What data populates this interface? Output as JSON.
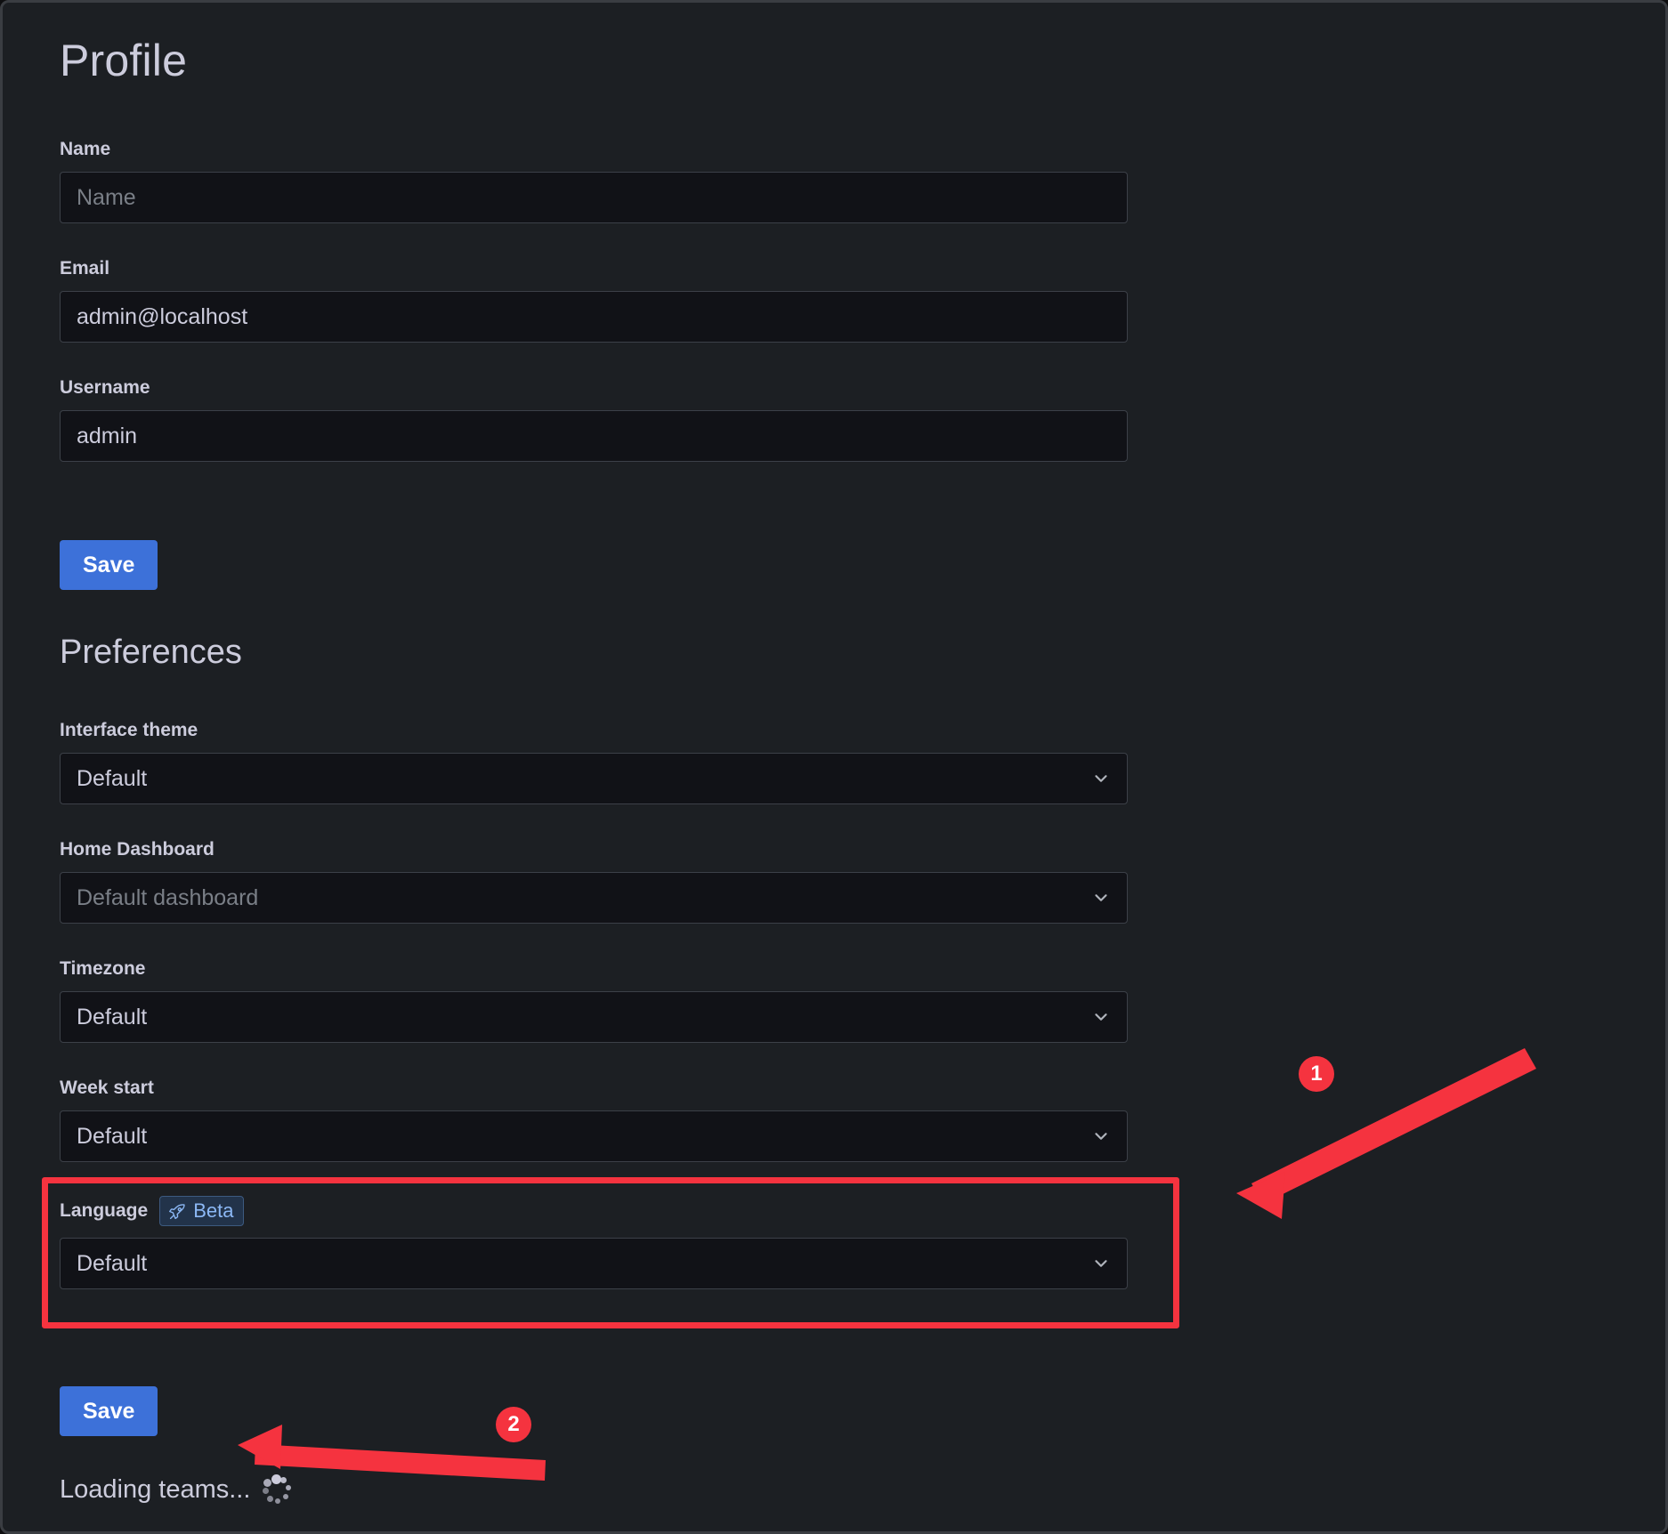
{
  "page": {
    "title": "Profile",
    "section_title": "Preferences"
  },
  "profile": {
    "fields": [
      {
        "label": "Name",
        "value": "",
        "placeholder": "Name"
      },
      {
        "label": "Email",
        "value": "admin@localhost",
        "placeholder": ""
      },
      {
        "label": "Username",
        "value": "admin",
        "placeholder": ""
      }
    ],
    "save_label": "Save"
  },
  "preferences": {
    "fields": [
      {
        "label": "Interface theme",
        "value": "Default",
        "is_placeholder": false
      },
      {
        "label": "Home Dashboard",
        "value": "Default dashboard",
        "is_placeholder": true
      },
      {
        "label": "Timezone",
        "value": "Default",
        "is_placeholder": false
      },
      {
        "label": "Week start",
        "value": "Default",
        "is_placeholder": false
      },
      {
        "label": "Language",
        "value": "Default",
        "is_placeholder": false,
        "badge": "Beta"
      }
    ],
    "save_label": "Save"
  },
  "status": {
    "loading_text": "Loading teams...",
    "spinner_icon": "circular-dots-spinner"
  },
  "icons": {
    "chevron": "chevron-down-icon",
    "rocket": "rocket-icon"
  },
  "annotations": {
    "markers": [
      {
        "number": "1",
        "target": "language-preference-row"
      },
      {
        "number": "2",
        "target": "preferences-save-button"
      }
    ],
    "highlight_color": "#f5333f",
    "accent_color": "#3d71d9"
  }
}
